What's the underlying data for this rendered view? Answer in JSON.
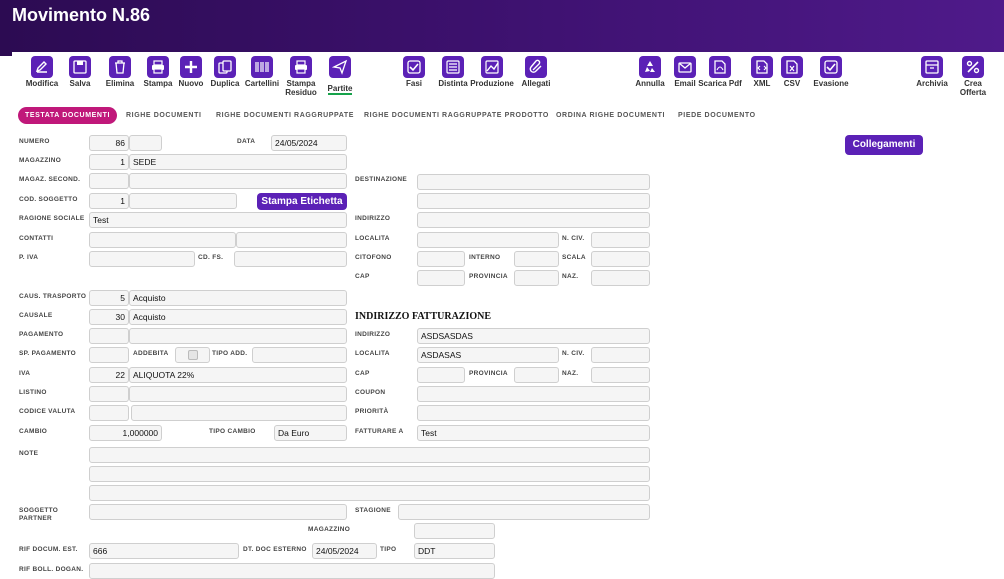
{
  "header": {
    "title": "Movimento N.86"
  },
  "toolbar": {
    "items": [
      {
        "label": "Modifica",
        "icon": "edit-icon"
      },
      {
        "label": "Salva",
        "icon": "save-icon"
      },
      {
        "label": "Elimina",
        "icon": "trash-icon"
      },
      {
        "label": "Stampa",
        "icon": "printer-icon"
      },
      {
        "label": "Nuovo",
        "icon": "plus-icon"
      },
      {
        "label": "Duplica",
        "icon": "copy-icon"
      },
      {
        "label": "Cartellini",
        "icon": "barcode-icon"
      },
      {
        "label": "Stampa Residuo",
        "icon": "printer-icon"
      },
      {
        "label": "Partite",
        "icon": "send-icon"
      },
      {
        "label": "Fasi",
        "icon": "check-icon"
      },
      {
        "label": "Distinta",
        "icon": "list-icon"
      },
      {
        "label": "Produzione",
        "icon": "chart-icon"
      },
      {
        "label": "Allegati",
        "icon": "paperclip-icon"
      },
      {
        "label": "Annulla",
        "icon": "recycle-icon"
      },
      {
        "label": "Email",
        "icon": "mail-icon"
      },
      {
        "label": "Scarica Pdf",
        "icon": "pdf-icon"
      },
      {
        "label": "XML",
        "icon": "xml-icon"
      },
      {
        "label": "CSV",
        "icon": "csv-icon"
      },
      {
        "label": "Evasione",
        "icon": "check-icon"
      },
      {
        "label": "Archivia",
        "icon": "archive-icon"
      },
      {
        "label": "Crea Offerta",
        "icon": "percent-icon"
      }
    ]
  },
  "tabs": [
    {
      "label": "TESTATA DOCUMENTI",
      "active": true
    },
    {
      "label": "RIGHE DOCUMENTI"
    },
    {
      "label": "RIGHE DOCUMENTI RAGGRUPPATE"
    },
    {
      "label": "RIGHE DOCUMENTI RAGGRUPPATE PRODOTTO"
    },
    {
      "label": "ORDINA RIGHE DOCUMENTI"
    },
    {
      "label": "PIEDE DOCUMENTO"
    }
  ],
  "buttons": {
    "collegamenti": "Collegamenti",
    "stampa_etichetta": "Stampa Etichetta"
  },
  "form": {
    "numero": {
      "label": "NUMERO",
      "value": "86"
    },
    "data": {
      "label": "DATA",
      "value": "24/05/2024"
    },
    "magazzino": {
      "label": "MAGAZZINO",
      "code": "1",
      "name": "SEDE"
    },
    "magaz_second": {
      "label": "MAGAZ. SECOND."
    },
    "cod_soggetto": {
      "label": "COD. SOGGETTO",
      "code": "1"
    },
    "ragione_sociale": {
      "label": "RAGIONE SOCIALE",
      "value": "Test"
    },
    "contatti": {
      "label": "CONTATTI"
    },
    "piva": {
      "label": "P. IVA"
    },
    "cdfs": {
      "label": "CD. FS."
    },
    "destinazione": {
      "label": "DESTINAZIONE"
    },
    "indirizzo": {
      "label": "INDIRIZZO"
    },
    "localita": {
      "label": "LOCALITA"
    },
    "nciv": {
      "label": "N. CIV."
    },
    "citofono": {
      "label": "CITOFONO"
    },
    "interno": {
      "label": "INTERNO"
    },
    "scala": {
      "label": "SCALA"
    },
    "cap": {
      "label": "CAP"
    },
    "provincia": {
      "label": "PROVINCIA"
    },
    "naz": {
      "label": "NAZ."
    },
    "caus_trasporto": {
      "label": "CAUS. TRASPORTO",
      "code": "5",
      "name": "Acquisto"
    },
    "causale": {
      "label": "CAUSALE",
      "code": "30",
      "name": "Acquisto"
    },
    "pagamento": {
      "label": "PAGAMENTO"
    },
    "sp_pagamento": {
      "label": "SP. PAGAMENTO"
    },
    "addebita": {
      "label": "ADDEBITA"
    },
    "tipo_add": {
      "label": "TIPO ADD."
    },
    "iva": {
      "label": "IVA",
      "code": "22",
      "name": "ALIQUOTA 22%"
    },
    "listino": {
      "label": "LISTINO"
    },
    "codice_valuta": {
      "label": "CODICE VALUTA"
    },
    "cambio": {
      "label": "CAMBIO",
      "value": "1,000000"
    },
    "tipo_cambio": {
      "label": "TIPO CAMBIO",
      "value": "Da Euro"
    },
    "note": {
      "label": "NOTE"
    },
    "soggetto_partner": {
      "label1": "SOGGETTO",
      "label2": "PARTNER"
    },
    "stagione": {
      "label": "STAGIONE"
    },
    "magazzino2": {
      "label": "MAGAZZINO"
    },
    "rif_docum_est": {
      "label": "RIF DOCUM. EST.",
      "value": "666"
    },
    "dt_doc_esterno": {
      "label": "DT. DOC ESTERNO",
      "value": "24/05/2024"
    },
    "tipo": {
      "label": "TIPO",
      "value": "DDT"
    },
    "rif_boll_dogan": {
      "label": "RIF BOLL. DOGAN."
    }
  },
  "fatturazione": {
    "title": "INDIRIZZO FATTURAZIONE",
    "indirizzo": {
      "label": "INDIRIZZO",
      "value": "ASDSASDAS"
    },
    "localita": {
      "label": "LOCALITA",
      "value": "ASDASAS"
    },
    "nciv": {
      "label": "N. CIV."
    },
    "cap": {
      "label": "CAP"
    },
    "provincia": {
      "label": "PROVINCIA"
    },
    "naz": {
      "label": "NAZ."
    },
    "coupon": {
      "label": "COUPON"
    },
    "priorita": {
      "label": "PRIORITÀ"
    },
    "fatturare_a": {
      "label": "FATTURARE A",
      "value": "Test"
    }
  }
}
